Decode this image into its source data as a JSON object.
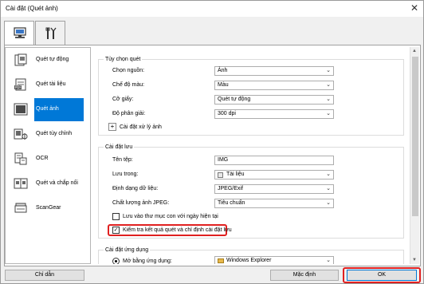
{
  "window": {
    "title": "Cài đặt (Quét ảnh)"
  },
  "colors": {
    "selection": "#0078d7",
    "highlight": "#e02020"
  },
  "sidebar": {
    "items": [
      {
        "label": "Quét tự động",
        "icon": "auto-scan-icon"
      },
      {
        "label": "Quét tài liệu",
        "icon": "document-scan-icon"
      },
      {
        "label": "Quét ảnh",
        "icon": "photo-scan-icon",
        "selected": true
      },
      {
        "label": "Quét tùy chỉnh",
        "icon": "custom-scan-icon"
      },
      {
        "label": "OCR",
        "icon": "ocr-icon"
      },
      {
        "label": "Quét và chắp nối",
        "icon": "stitch-icon"
      },
      {
        "label": "ScanGear",
        "icon": "scangear-icon"
      }
    ]
  },
  "scan_options": {
    "title": "Tùy chọn quét",
    "source_label": "Chọn nguồn:",
    "source_value": "Ảnh",
    "color_label": "Chế độ màu:",
    "color_value": "Màu",
    "paper_label": "Cỡ giấy:",
    "paper_value": "Quét tự động",
    "resolution_label": "Độ phân giải:",
    "resolution_value": "300 dpi",
    "image_processing_label": "Cài đặt xử lý ảnh"
  },
  "save_settings": {
    "title": "Cài đặt lưu",
    "filename_label": "Tên tệp:",
    "filename_value": "IMG",
    "save_in_label": "Lưu trong:",
    "save_in_value": "Tài liệu",
    "format_label": "Định dạng dữ liệu:",
    "format_value": "JPEG/Exif",
    "quality_label": "Chất lượng ảnh JPEG:",
    "quality_value": "Tiêu chuẩn",
    "subfolder_label": "Lưu vào thư mục con với ngày hiện tại",
    "check_result_label": "Kiểm tra kết quả quét và chỉ định cài đặt lưu"
  },
  "app_settings": {
    "title": "Cài đặt ứng dụng",
    "open_with_label": "Mở bằng ứng dụng:",
    "open_with_value": "Windows Explorer"
  },
  "buttons": {
    "help": "Chỉ dẫn",
    "defaults": "Mặc định",
    "ok": "OK"
  }
}
